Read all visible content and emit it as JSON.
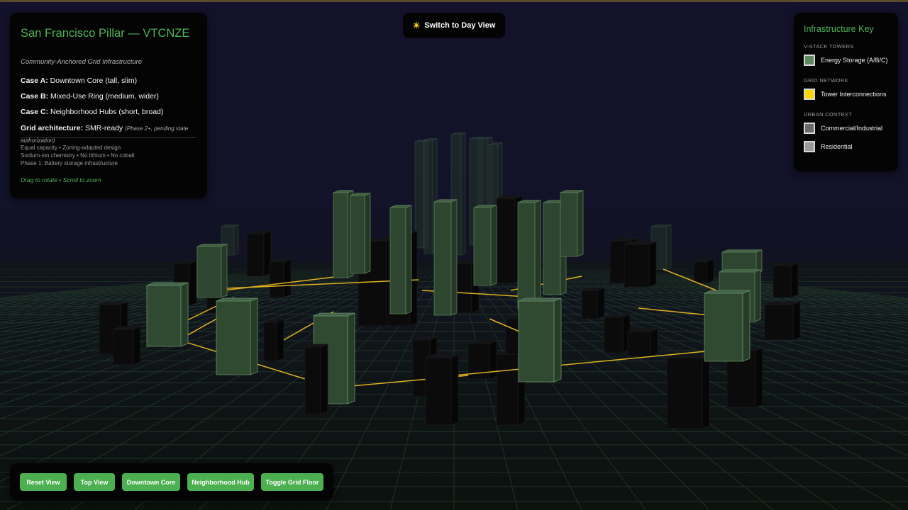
{
  "info": {
    "title": "San Francisco Pillar — VTCNZE",
    "subtitle": "Community-Anchored Grid Infrastructure",
    "cases": [
      {
        "label": "Case A:",
        "text": "Downtown Core (tall, slim)"
      },
      {
        "label": "Case B:",
        "text": "Mixed-Use Ring (medium, wider)"
      },
      {
        "label": "Case C:",
        "text": "Neighborhood Hubs (short, broad)"
      }
    ],
    "grid_label": "Grid architecture:",
    "grid_value": "SMR-ready",
    "grid_note": "(Phase 2+, pending state authorization)",
    "notes": [
      "Equal capacity • Zoning-adapted design",
      "Sodium-ion chemistry • No lithium • No cobalt",
      "Phase 1: Battery storage infrastructure"
    ],
    "hint": "Drag to rotate • Scroll to zoom"
  },
  "day_button": {
    "icon": "☀",
    "label": "Switch to Day View"
  },
  "legend": {
    "title": "Infrastructure Key",
    "sections": [
      {
        "heading": "V-STACK TOWERS",
        "items": [
          {
            "label": "Energy Storage (A/B/C)",
            "color": "#5e8a5e"
          }
        ]
      },
      {
        "heading": "GRID NETWORK",
        "items": [
          {
            "label": "Tower Interconnections",
            "color": "#ffd700"
          }
        ]
      },
      {
        "heading": "URBAN CONTEXT",
        "items": [
          {
            "label": "Commercial/Industrial",
            "color": "#6a6a6a"
          },
          {
            "label": "Residential",
            "color": "#9a9a9a"
          }
        ]
      }
    ]
  },
  "controls": {
    "reset": "Reset View",
    "top": "Top View",
    "downtown": "Downtown Core",
    "hub": "Neighborhood Hub",
    "grid": "Toggle Grid Floor"
  },
  "colors": {
    "accent": "#4fb35a",
    "button": "#4caf50",
    "tower": "#2f4a30",
    "interconnect": "#e0b020",
    "building": "#0a0a0a"
  }
}
